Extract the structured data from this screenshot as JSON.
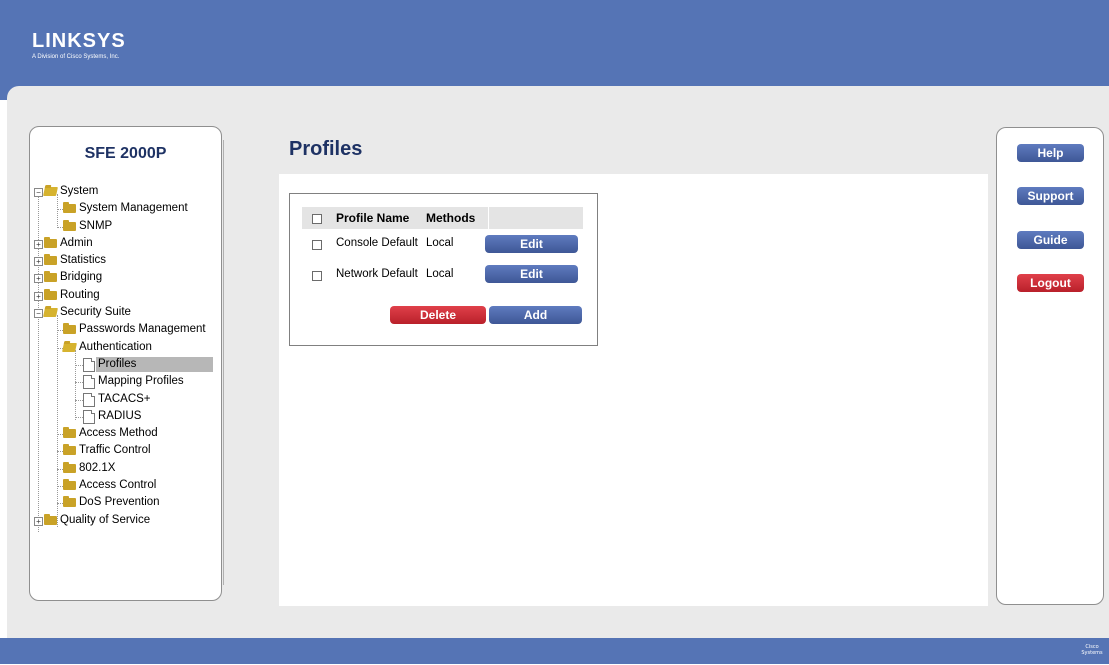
{
  "brand": {
    "name": "LINKSYS",
    "subtitle": "A Division of Cisco Systems, Inc."
  },
  "colors": {
    "banner": "#5574b5",
    "title": "#1e3264",
    "button_blue": "#4a63a8",
    "button_red": "#c9303a",
    "selected": "#b7b7b7"
  },
  "sidebar": {
    "device_title": "SFE 2000P",
    "tree": [
      {
        "label": "System",
        "expanded": true
      },
      {
        "label": "System Management"
      },
      {
        "label": "SNMP"
      },
      {
        "label": "Admin",
        "expanded": false
      },
      {
        "label": "Statistics",
        "expanded": false
      },
      {
        "label": "Bridging",
        "expanded": false
      },
      {
        "label": "Routing",
        "expanded": false
      },
      {
        "label": "Security Suite",
        "expanded": true
      },
      {
        "label": "Passwords Management"
      },
      {
        "label": "Authentication"
      },
      {
        "label": "Profiles",
        "selected": true
      },
      {
        "label": "Mapping Profiles"
      },
      {
        "label": "TACACS+"
      },
      {
        "label": "RADIUS"
      },
      {
        "label": "Access Method"
      },
      {
        "label": "Traffic Control"
      },
      {
        "label": "802.1X"
      },
      {
        "label": "Access Control"
      },
      {
        "label": "DoS Prevention"
      },
      {
        "label": "Quality of Service",
        "expanded": false
      }
    ]
  },
  "main": {
    "title": "Profiles",
    "table": {
      "headers": [
        "Profile Name",
        "Methods"
      ],
      "rows": [
        {
          "profile_name": "Console Default",
          "methods": "Local",
          "action": "Edit"
        },
        {
          "profile_name": "Network Default",
          "methods": "Local",
          "action": "Edit"
        }
      ]
    },
    "buttons": {
      "delete": "Delete",
      "add": "Add"
    }
  },
  "right_nav": {
    "help": "Help",
    "support": "Support",
    "guide": "Guide",
    "logout": "Logout"
  },
  "footer": {
    "cisco_mark": "Cisco Systems"
  }
}
